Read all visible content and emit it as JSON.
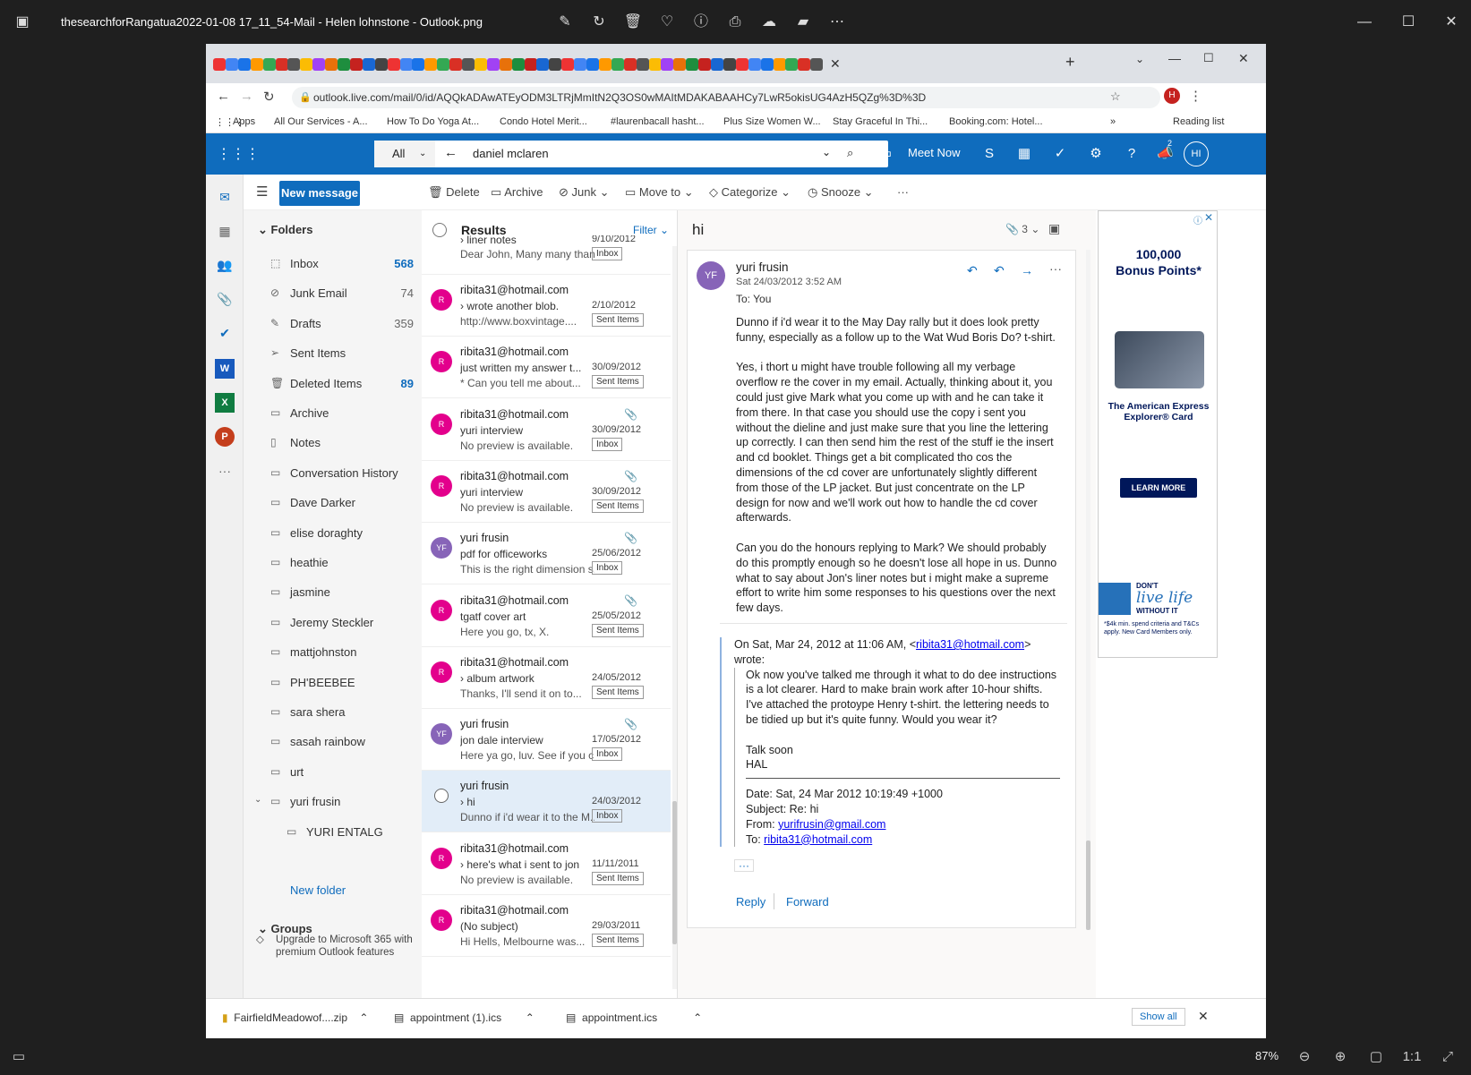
{
  "viewer": {
    "title": "thesearchforRangatua2022-01-08 17_11_54-Mail - Helen lohnstone - Outlook.png",
    "zoom": "87%"
  },
  "browser": {
    "url": "outlook.live.com/mail/0/id/AQQkADAwATEyODM3LTRjMmItN2Q3OS0wMAItMDAKABAAHCy7LwR5okisUG4AzH5QZg%3D%3D",
    "profile_initial": "H",
    "bookmarks": [
      "Apps",
      "All Our Services - A...",
      "How To Do Yoga At...",
      "Condo Hotel Merit...",
      "#laurenbacall hasht...",
      "Plus Size Women W...",
      "Stay Graceful In Thi...",
      "Booking.com: Hotel..."
    ],
    "reading_list": "Reading list"
  },
  "header": {
    "scope": "All",
    "query": "daniel mclaren",
    "meet_now": "Meet Now",
    "notif_count": "2",
    "avatar": "HI"
  },
  "toolbar": {
    "new_message": "New message",
    "delete": "Delete",
    "archive": "Archive",
    "junk": "Junk",
    "move_to": "Move to",
    "categorize": "Categorize",
    "snooze": "Snooze",
    "more": "···"
  },
  "folders": {
    "heading": "Folders",
    "items": [
      {
        "name": "Inbox",
        "count": "568",
        "icon": "inbox-icon"
      },
      {
        "name": "Junk Email",
        "count": "74",
        "icon": "junk-icon"
      },
      {
        "name": "Drafts",
        "count": "359",
        "icon": "pencil-icon"
      },
      {
        "name": "Sent Items",
        "count": "",
        "icon": "send-icon"
      },
      {
        "name": "Deleted Items",
        "count": "89",
        "icon": "trash-icon"
      },
      {
        "name": "Archive",
        "count": "",
        "icon": "archive-icon"
      },
      {
        "name": "Notes",
        "count": "",
        "icon": "note-icon"
      },
      {
        "name": "Conversation History",
        "count": "",
        "icon": "folder-icon"
      },
      {
        "name": "Dave Darker",
        "count": "",
        "icon": "folder-icon"
      },
      {
        "name": "elise doraghty",
        "count": "",
        "icon": "folder-icon"
      },
      {
        "name": "heathie",
        "count": "",
        "icon": "folder-icon"
      },
      {
        "name": "jasmine",
        "count": "",
        "icon": "folder-icon"
      },
      {
        "name": "Jeremy Steckler",
        "count": "",
        "icon": "folder-icon"
      },
      {
        "name": "mattjohnston",
        "count": "",
        "icon": "folder-icon"
      },
      {
        "name": "PH'BEEBEE",
        "count": "",
        "icon": "folder-icon"
      },
      {
        "name": "sara shera",
        "count": "",
        "icon": "folder-icon"
      },
      {
        "name": "sasah rainbow",
        "count": "",
        "icon": "folder-icon"
      },
      {
        "name": "urt",
        "count": "",
        "icon": "folder-icon"
      },
      {
        "name": "yuri frusin",
        "count": "",
        "icon": "folder-icon"
      },
      {
        "name": "YURI ENTALG",
        "count": "",
        "icon": "folder-icon"
      }
    ],
    "new_folder": "New folder",
    "groups": "Groups",
    "upgrade": "Upgrade to Microsoft 365 with premium Outlook features"
  },
  "results": {
    "heading": "Results",
    "filter": "Filter",
    "partial_top": {
      "subject": "liner notes",
      "date": "9/10/2012",
      "preview": "Dear John, Many many than...",
      "tag": "Inbox"
    },
    "items": [
      {
        "initials": "R",
        "color": "#e3008c",
        "from": "ribita31@hotmail.com",
        "subject": "wrote another blob.",
        "date": "2/10/2012",
        "preview": "http://www.boxvintage....",
        "tag": "Sent Items",
        "attach": false,
        "chevron": true
      },
      {
        "initials": "R",
        "color": "#e3008c",
        "from": "ribita31@hotmail.com",
        "subject": "just written my answer t...",
        "date": "30/09/2012",
        "preview": "* Can you tell me about...",
        "tag": "Sent Items",
        "attach": false,
        "chevron": false
      },
      {
        "initials": "R",
        "color": "#e3008c",
        "from": "ribita31@hotmail.com",
        "subject": "yuri interview",
        "date": "30/09/2012",
        "preview": "No preview is available.",
        "tag": "Inbox",
        "attach": true,
        "chevron": false
      },
      {
        "initials": "R",
        "color": "#e3008c",
        "from": "ribita31@hotmail.com",
        "subject": "yuri interview",
        "date": "30/09/2012",
        "preview": "No preview is available.",
        "tag": "Sent Items",
        "attach": true,
        "chevron": false
      },
      {
        "initials": "YF",
        "color": "#8764b8",
        "from": "yuri frusin",
        "subject": "pdf for officeworks",
        "date": "25/06/2012",
        "preview": "This is the right dimension s...",
        "tag": "Inbox",
        "attach": true,
        "chevron": false
      },
      {
        "initials": "R",
        "color": "#e3008c",
        "from": "ribita31@hotmail.com",
        "subject": "tgatf cover art",
        "date": "25/05/2012",
        "preview": "Here you go, tx, X.",
        "tag": "Sent Items",
        "attach": true,
        "chevron": false
      },
      {
        "initials": "R",
        "color": "#e3008c",
        "from": "ribita31@hotmail.com",
        "subject": "album artwork",
        "date": "24/05/2012",
        "preview": "Thanks, I'll send it on to...",
        "tag": "Sent Items",
        "attach": false,
        "chevron": true
      },
      {
        "initials": "YF",
        "color": "#8764b8",
        "from": "yuri frusin",
        "subject": "jon dale interview",
        "date": "17/05/2012",
        "preview": "Here ya go, luv. See if you c...",
        "tag": "Inbox",
        "attach": true,
        "chevron": false
      },
      {
        "initials": "",
        "color": "",
        "from": "yuri frusin",
        "subject": "hi",
        "date": "24/03/2012",
        "preview": "Dunno if i'd wear it to the M...",
        "tag": "Inbox",
        "attach": false,
        "chevron": true,
        "selected": true
      },
      {
        "initials": "R",
        "color": "#e3008c",
        "from": "ribita31@hotmail.com",
        "subject": "here's what i sent to jon",
        "date": "11/11/2011",
        "preview": "No preview is available.",
        "tag": "Sent Items",
        "attach": false,
        "chevron": true
      },
      {
        "initials": "R",
        "color": "#e3008c",
        "from": "ribita31@hotmail.com",
        "subject": "(No subject)",
        "date": "29/03/2011",
        "preview": "Hi Hells, Melbourne was...",
        "tag": "Sent Items",
        "attach": false,
        "chevron": false
      }
    ]
  },
  "message": {
    "subject": "hi",
    "attach_count": "3",
    "sender_initials": "YF",
    "sender": "yuri frusin",
    "date": "Sat 24/03/2012 3:52 AM",
    "to": "To:  You",
    "body": [
      "Dunno if i'd wear it to the May Day rally but it does look pretty funny, especially as a follow up to the Wat Wud Boris Do? t-shirt.",
      "Yes, i thort u might have trouble following all my verbage overflow re the cover in my email. Actually, thinking about it, you could just give Mark what you come up with and he can take it from there. In that case you should use the copy i sent you without the dieline and just make sure that you line the lettering up correctly. I can then send him the rest of the stuff ie the insert and cd booklet. Things get a bit complicated tho cos the dimensions of the cd cover are unfortunately slightly different from those of the LP jacket. But just concentrate on the LP design for now and we'll work out how to handle the cd cover afterwards.",
      "Can you do the honours replying to Mark? We should probably do this promptly enough so he doesn't lose all hope in us. Dunno what to say about Jon's liner notes but i might make a supreme effort to write him some responses to his questions over the next few days."
    ],
    "quote_intro": "On Sat, Mar 24, 2012 at 11:06 AM, <",
    "quote_email": "ribita31@hotmail.com",
    "quote_intro_end": "> wrote:",
    "quote_lines": [
      "Ok now you've talked me through it what to do dee instructions is a lot clearer. Hard to make brain work after 10-hour shifts.",
      "I've attached the protoype Henry t-shirt. the lettering needs to be tidied up but it's quite funny. Would you wear it?"
    ],
    "talk_soon": "Talk soon",
    "signature": "HAL",
    "meta_date": "Date: Sat, 24 Mar 2012 10:19:49 +1000",
    "meta_subject": "Subject: Re: hi",
    "meta_from_label": "From: ",
    "meta_from": "yurifrusin@gmail.com",
    "meta_to_label": "To: ",
    "meta_to": "ribita31@hotmail.com",
    "ellipsis": "···",
    "reply": "Reply",
    "forward": "Forward"
  },
  "ad": {
    "headline1": "100,000",
    "headline2": "Bonus Points*",
    "card_name": "The American Express Explorer® Card",
    "cta": "LEARN MORE",
    "tag1": "DON'T",
    "tag2": "live life",
    "tag3": "WITHOUT IT",
    "fine": "*$4k min. spend criteria and T&Cs apply. New Card Members only."
  },
  "downloads": {
    "items": [
      "FairfieldMeadowof....zip",
      "appointment (1).ics",
      "appointment.ics"
    ],
    "show_all": "Show all"
  }
}
